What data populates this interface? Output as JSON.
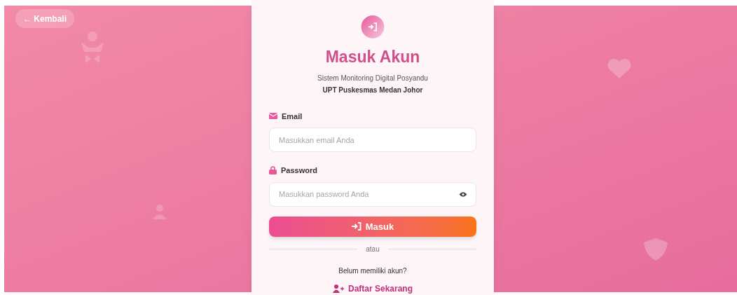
{
  "back_button": {
    "label": "← Kembali"
  },
  "title": "Masuk Akun",
  "subtitle": "Sistem Monitoring Digital Posyandu",
  "organization": "UPT Puskesmas Medan Johor",
  "fields": [
    {
      "kind": "email",
      "label": "Email",
      "placeholder": "Masukkan email Anda"
    },
    {
      "kind": "password",
      "label": "Password",
      "placeholder": "Masukkan password Anda"
    }
  ],
  "submit_button": {
    "label": "Masuk"
  },
  "divider": "atau",
  "register_prompt": "Belum memiliki akun?",
  "register_link": {
    "label": "Daftar Sekarang"
  }
}
